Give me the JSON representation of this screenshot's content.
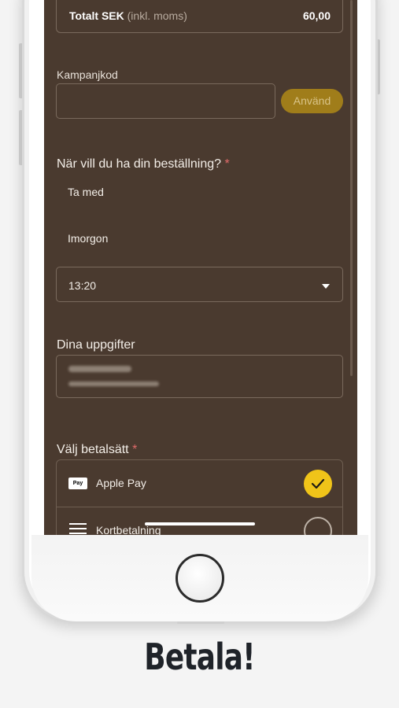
{
  "order_summary": {
    "total_label": "Totalt SEK",
    "total_note": "(inkl. moms)",
    "total_value": "60,00"
  },
  "campaign": {
    "label": "Kampanjkod",
    "input_value": "",
    "apply_label": "Använd"
  },
  "delivery": {
    "question": "När vill du ha din beställning?",
    "required_mark": "*",
    "mode": "Ta med",
    "day": "Imorgon",
    "time_selected": "13:20"
  },
  "details": {
    "title": "Dina uppgifter"
  },
  "payment": {
    "title": "Välj betalsätt",
    "required_mark": "*",
    "options": [
      {
        "label": "Apple Pay",
        "badge": "Pay",
        "selected": true
      },
      {
        "label": "Kortbetalning",
        "selected": false
      }
    ]
  },
  "caption": "Betala!",
  "colors": {
    "screen_bg": "#4a3a2f",
    "accent": "#f0c419",
    "apply_button": "#a07d1a"
  }
}
